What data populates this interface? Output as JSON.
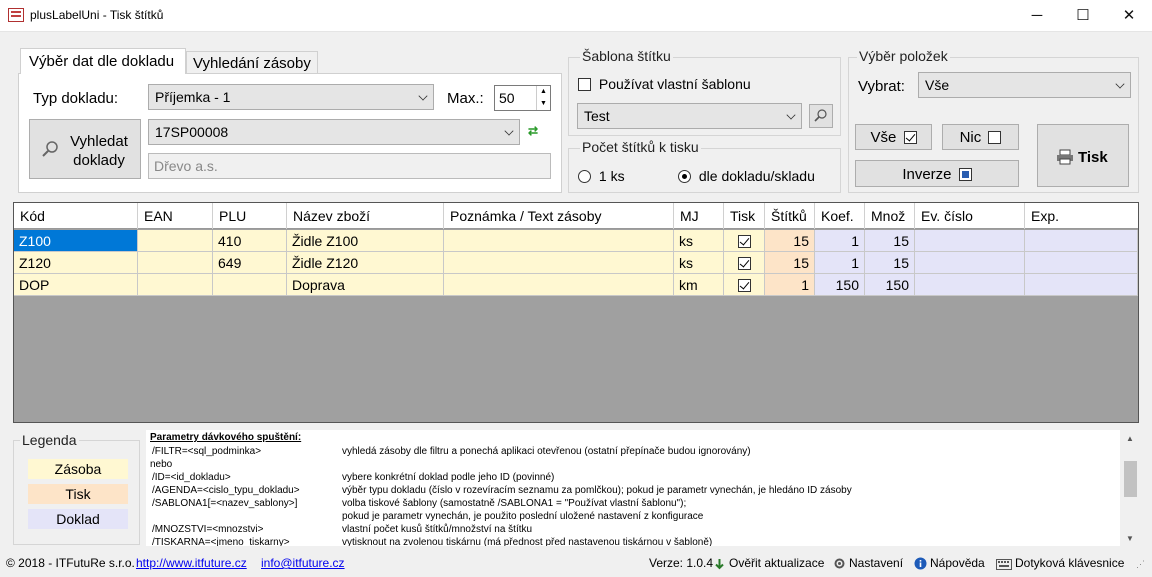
{
  "window": {
    "title": "plusLabelUni - Tisk štítků",
    "min": "─",
    "max": "☐",
    "close": "✕"
  },
  "tabs": [
    {
      "label": "Výběr dat dle dokladu"
    },
    {
      "label": "Vyhledání zásoby"
    }
  ],
  "doc": {
    "type_label": "Typ dokladu:",
    "type_value": "Příjemka - 1",
    "max_label": "Max.:",
    "max_value": "50",
    "search_label_1": "Vyhledat",
    "search_label_2": "doklady",
    "doc_number": "17SP00008",
    "partner_placeholder": "Dřevo a.s."
  },
  "template": {
    "title": "Šablona štítku",
    "custom_label": "Používat vlastní šablonu",
    "custom_checked": false,
    "selected": "Test"
  },
  "count": {
    "title": "Počet štítků k tisku",
    "opt1": "1 ks",
    "opt2": "dle dokladu/skladu",
    "selected": 2
  },
  "selection": {
    "title": "Výběr položek",
    "select_label": "Vybrat:",
    "select_value": "Vše",
    "all_label": "Vše",
    "none_label": "Nic",
    "invert_label": "Inverze",
    "print_label": "Tisk"
  },
  "grid": {
    "columns": [
      "Kód",
      "EAN",
      "PLU",
      "Název zboží",
      "Poznámka / Text zásoby",
      "MJ",
      "Tisk",
      "Štítků",
      "Koef.",
      "Množ",
      "Ev. číslo",
      "Exp."
    ],
    "rows": [
      {
        "kod": "Z100",
        "ean": "",
        "plu": "410",
        "nazev": "Židle Z100",
        "poznamka": "",
        "mj": "ks",
        "tisk": true,
        "stitku": "15",
        "koef": "1",
        "mnoz": "15",
        "ev": "",
        "exp": ""
      },
      {
        "kod": "Z120",
        "ean": "",
        "plu": "649",
        "nazev": "Židle Z120",
        "poznamka": "",
        "mj": "ks",
        "tisk": true,
        "stitku": "15",
        "koef": "1",
        "mnoz": "15",
        "ev": "",
        "exp": ""
      },
      {
        "kod": "DOP",
        "ean": "",
        "plu": "",
        "nazev": "Doprava",
        "poznamka": "",
        "mj": "km",
        "tisk": true,
        "stitku": "1",
        "koef": "150",
        "mnoz": "150",
        "ev": "",
        "exp": ""
      }
    ]
  },
  "legend": {
    "title": "Legenda",
    "items": [
      {
        "label": "Zásoba",
        "color": "#fff8d2"
      },
      {
        "label": "Tisk",
        "color": "#fde4c8"
      },
      {
        "label": "Doklad",
        "color": "#e4e4f8"
      }
    ]
  },
  "params": {
    "heading": "Parametry dávkového   spuštění:",
    "lines": [
      {
        "left": "/FILTR=<sql_podminka>",
        "right": "vyhledá zásoby dle filtru a ponechá aplikaci otevřenou (ostatní přepínače budou ignorovány)"
      },
      {
        "left": "nebo",
        "right": ""
      },
      {
        "left": "/ID=<id_dokladu>",
        "right": "vybere konkrétní doklad podle jeho ID (povinné)"
      },
      {
        "left": "/AGENDA=<cislo_typu_dokladu>",
        "right": "výběr typu dokladu (číslo v rozevíracím seznamu za pomlčkou); pokud je parametr vynechán, je hledáno ID zásoby"
      },
      {
        "left": "/SABLONA1[=<nazev_sablony>]",
        "right": "volba tiskové šablony (samostatně /SABLONA1 = \"Používat vlastní šablonu\");"
      },
      {
        "left": "",
        "right": "pokud je parametr vynechán, je použito poslední uložené nastavení z konfigurace"
      },
      {
        "left": "/MNOZSTVI=<mnozstvi>",
        "right": "vlastní počet kusů štítků/množství na štítku"
      },
      {
        "left": "/TISKARNA=<jmeno_tiskarny>",
        "right": "vytisknout na zvolenou tiskárnu (má přednost před nastavenou tiskárnou v šabloně)"
      }
    ]
  },
  "status": {
    "copyright": "© 2018 - ITFutuRe s.r.o.",
    "web": "http://www.itfuture.cz",
    "email": "info@itfuture.cz",
    "version": "Verze: 1.0.4",
    "update": "Ověřit aktualizace",
    "settings": "Nastavení",
    "help": "Nápověda",
    "keyboard": "Dotyková klávesnice"
  }
}
